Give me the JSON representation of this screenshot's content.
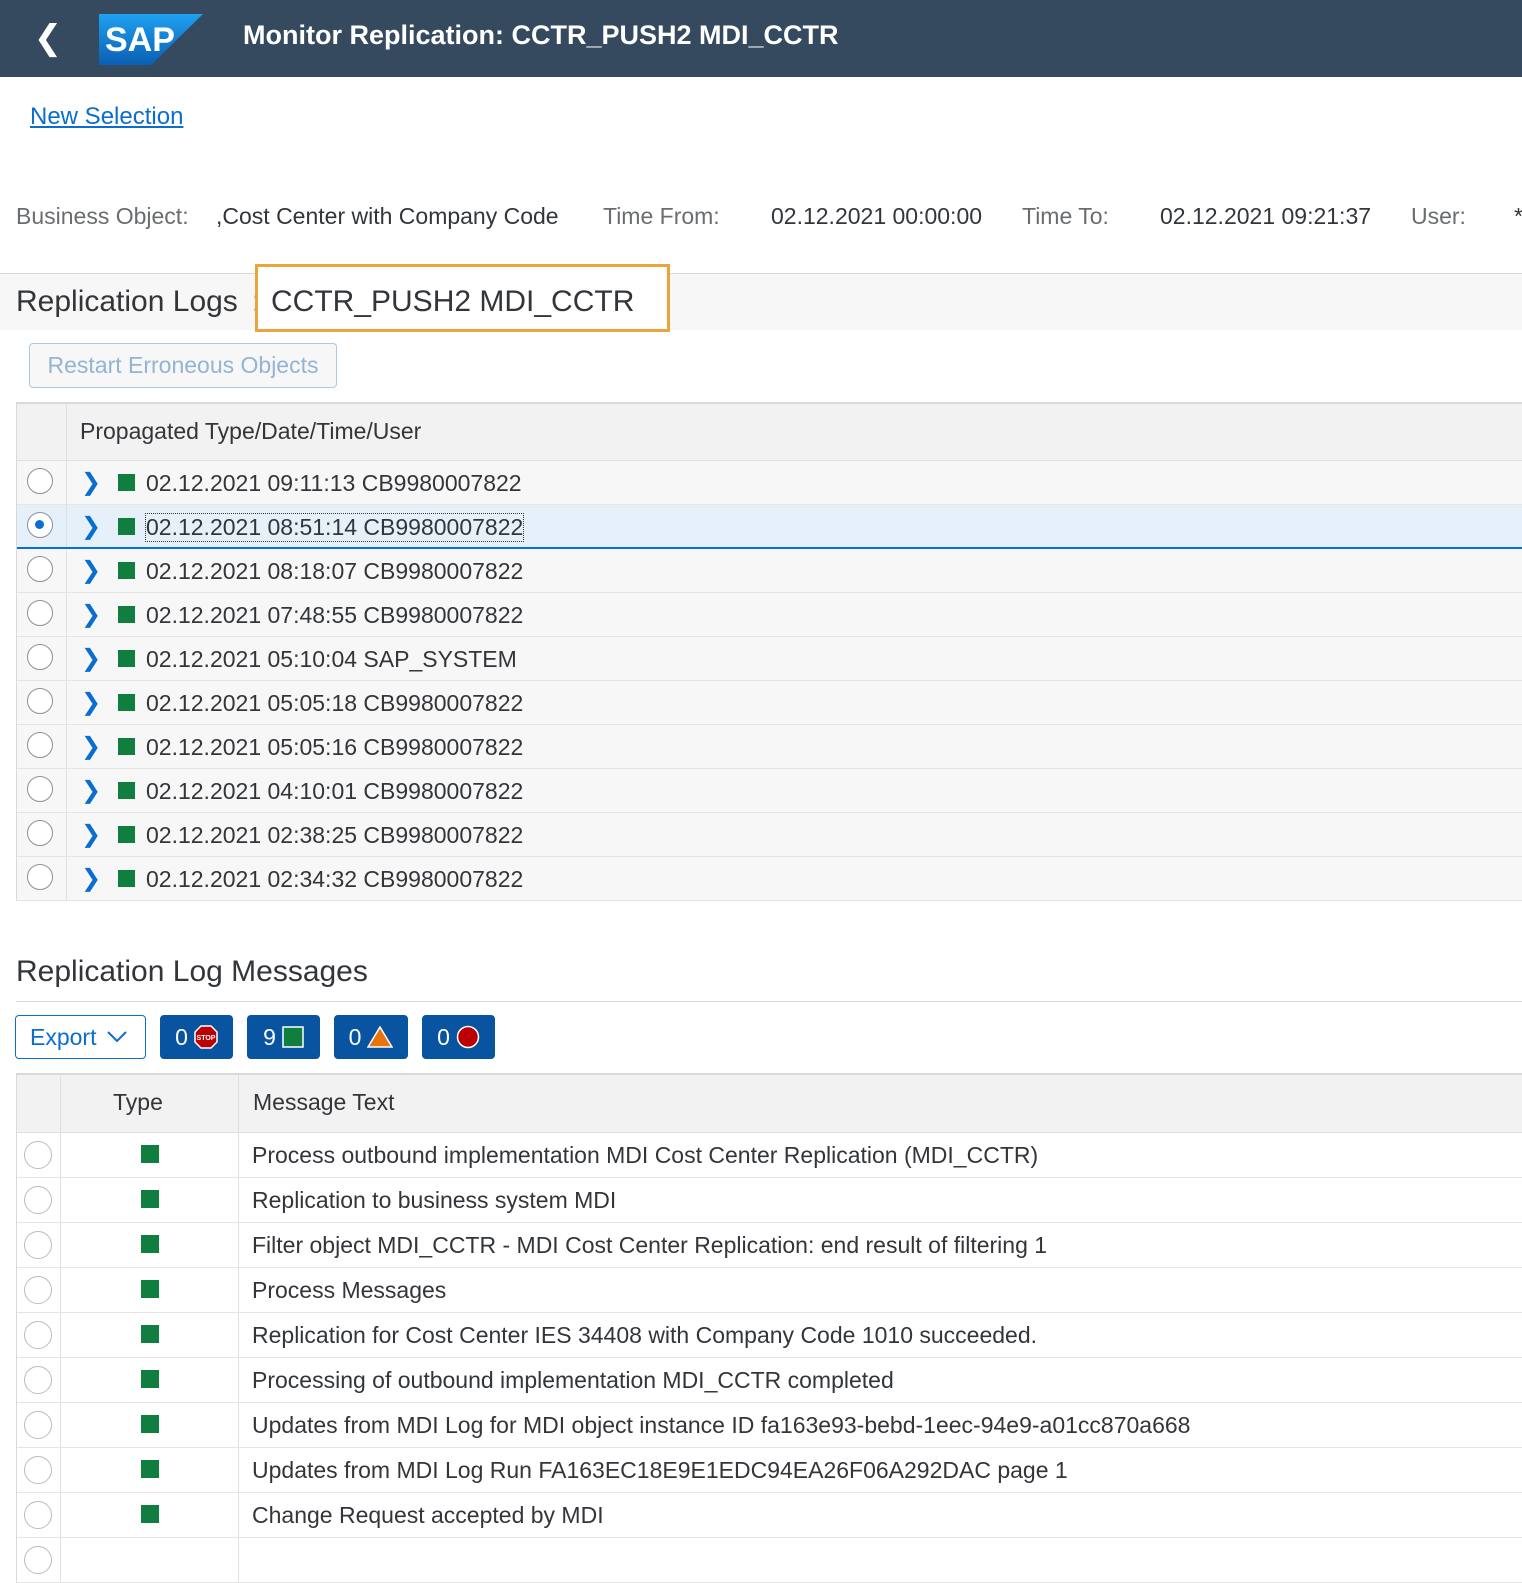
{
  "shell": {
    "title": "Monitor Replication: CCTR_PUSH2 MDI_CCTR",
    "logo_text": "SAP"
  },
  "links": {
    "new_selection": "New Selection"
  },
  "filters": {
    "business_object_label": "Business Object:",
    "business_object_value": ",Cost Center with Company Code",
    "time_from_label": "Time From:",
    "time_from_value": "02.12.2021 00:00:00",
    "time_to_label": "Time To:",
    "time_to_value": "02.12.2021 09:21:37",
    "user_label": "User:",
    "user_value": "*"
  },
  "logs": {
    "title": "Replication Logs",
    "separator": ":",
    "highlight": "CCTR_PUSH2 MDI_CCTR",
    "restart_button": "Restart Erroneous Objects",
    "column_header": "Propagated Type/Date/Time/User",
    "rows": [
      {
        "text": "02.12.2021 09:11:13 CB9980007822"
      },
      {
        "text": "02.12.2021 08:51:14 CB9980007822"
      },
      {
        "text": "02.12.2021 08:18:07 CB9980007822"
      },
      {
        "text": "02.12.2021 07:48:55 CB9980007822"
      },
      {
        "text": "02.12.2021 05:10:04 SAP_SYSTEM"
      },
      {
        "text": "02.12.2021 05:05:18 CB9980007822"
      },
      {
        "text": "02.12.2021 05:05:16 CB9980007822"
      },
      {
        "text": "02.12.2021 04:10:01 CB9980007822"
      },
      {
        "text": "02.12.2021 02:38:25 CB9980007822"
      },
      {
        "text": "02.12.2021 02:34:32 CB9980007822"
      }
    ],
    "selected_index": 1
  },
  "messages": {
    "title": "Replication Log Messages",
    "export_button": "Export",
    "counts": {
      "stop": "0",
      "success": "9",
      "warning": "0",
      "error": "0"
    },
    "col_type": "Type",
    "col_text": "Message Text",
    "rows": [
      "Process outbound implementation MDI Cost Center Replication (MDI_CCTR)",
      "Replication to business system MDI",
      "Filter object MDI_CCTR - MDI Cost Center Replication: end result of filtering 1",
      "Process Messages",
      "Replication for Cost Center IES 34408 with Company Code 1010 succeeded.",
      "Processing of outbound implementation MDI_CCTR completed",
      "Updates from MDI Log for MDI object instance ID fa163e93-bebd-1eec-94e9-a01cc870a668",
      "Updates from MDI Log Run FA163EC18E9E1EDC94EA26F06A292DAC page 1",
      "Change Request accepted by MDI"
    ]
  },
  "colors": {
    "shell": "#354a5f",
    "success": "#107e3e",
    "accent": "#0a6ed1",
    "highlight_border": "#e9a53a"
  }
}
